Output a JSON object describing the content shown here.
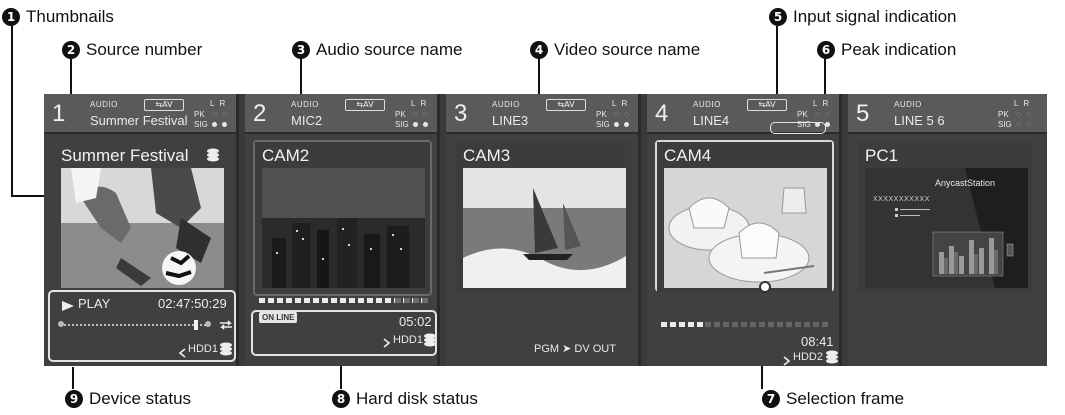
{
  "callouts": {
    "c1": {
      "num": "1",
      "label": "Thumbnails"
    },
    "c2": {
      "num": "2",
      "label": "Source number"
    },
    "c3": {
      "num": "3",
      "label": "Audio source name"
    },
    "c4": {
      "num": "4",
      "label": "Video source name"
    },
    "c5": {
      "num": "5",
      "label": "Input signal indication"
    },
    "c6": {
      "num": "6",
      "label": "Peak indication"
    },
    "c7": {
      "num": "7",
      "label": "Selection frame"
    },
    "c8": {
      "num": "8",
      "label": "Hard disk status"
    },
    "c9": {
      "num": "9",
      "label": "Device status"
    }
  },
  "meters": {
    "audio_label": "AUDIO",
    "av_badge": "⇆AV",
    "lr": "LR",
    "pk": "PK",
    "sig": "SIG"
  },
  "channels": [
    {
      "number": "1",
      "audio_name": "Summer Festival",
      "video_name": "Summer Festival",
      "selected": true
    },
    {
      "number": "2",
      "audio_name": "MIC2",
      "video_name": "CAM2"
    },
    {
      "number": "3",
      "audio_name": "LINE3",
      "video_name": "CAM3"
    },
    {
      "number": "4",
      "audio_name": "LINE4",
      "video_name": "CAM4"
    },
    {
      "number": "5",
      "audio_name": "LINE 5 6",
      "video_name": "PC1"
    }
  ],
  "status1": {
    "play": "PLAY",
    "timecode": "02:47:50:29",
    "device": "HDD1"
  },
  "status2": {
    "online": "ON LINE",
    "remaining": "05:02",
    "device": "HDD1"
  },
  "status3": {
    "route": "PGM ➤ DV OUT"
  },
  "status4": {
    "remaining": "08:41",
    "device": "HDD2"
  },
  "pc1": {
    "title": "AnycastStation",
    "line": "XXXXXXXXXXX"
  }
}
